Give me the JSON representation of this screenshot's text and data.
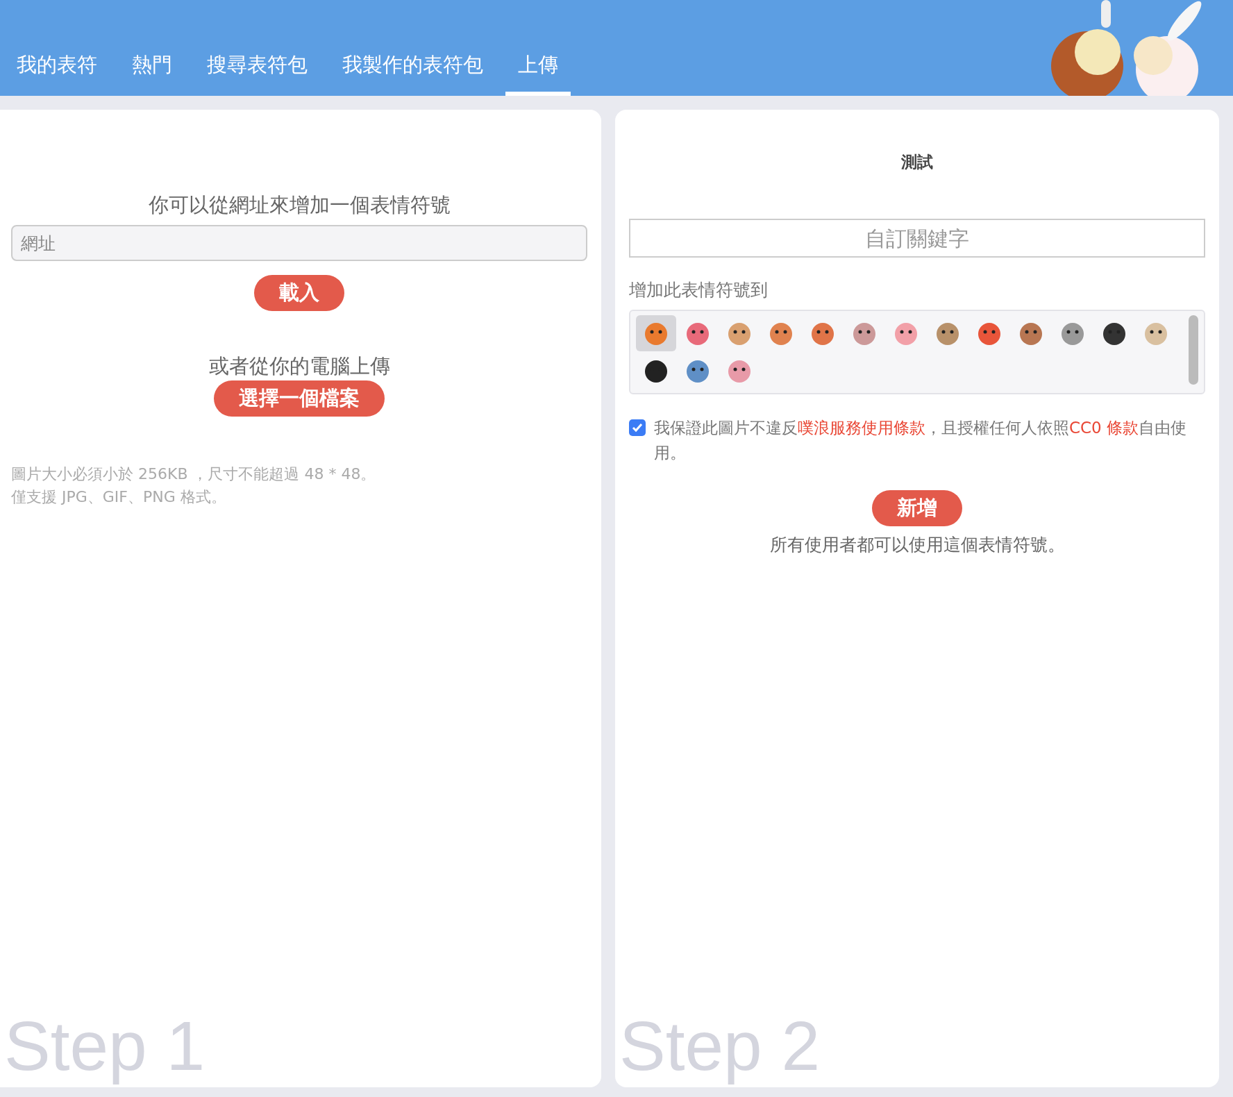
{
  "nav": {
    "tabs": [
      {
        "label": "我的表符",
        "selected": false
      },
      {
        "label": "熱門",
        "selected": false
      },
      {
        "label": "搜尋表符包",
        "selected": false
      },
      {
        "label": "我製作的表符包",
        "selected": false
      },
      {
        "label": "上傳",
        "selected": true
      }
    ]
  },
  "step1": {
    "heading": "你可以從網址來增加一個表情符號",
    "url_field": {
      "placeholder": "網址"
    },
    "load_button": "載入",
    "upload_heading": "或者從你的電腦上傳",
    "choose_button": "選擇一個檔案",
    "notes": [
      "圖片大小必須小於 256KB ，尺寸不能超過 48 * 48。",
      "僅支援 JPG、GIF、PNG 格式。"
    ],
    "watermark": "Step 1"
  },
  "step2": {
    "preview_label": "測試",
    "keyword_field": {
      "placeholder": "自訂關鍵字"
    },
    "add_to_label": "增加此表情符號到",
    "packs": [
      {
        "selected": true
      },
      {
        "selected": false
      },
      {
        "selected": false
      },
      {
        "selected": false
      },
      {
        "selected": false
      },
      {
        "selected": false
      },
      {
        "selected": false
      },
      {
        "selected": false
      },
      {
        "selected": false
      },
      {
        "selected": false
      },
      {
        "selected": false
      },
      {
        "selected": false
      },
      {
        "selected": false
      },
      {
        "selected": false
      },
      {
        "selected": false
      },
      {
        "selected": false
      }
    ],
    "agreement": {
      "checked": true,
      "text": "我保證此圖片不違反",
      "link1": "噗浪服務使用條款",
      "middle": "，且授權任何人依照",
      "link2": "CC0 條款",
      "end": "自由使用。"
    },
    "add_button": "新增",
    "public_note": "所有使用者都可以使用這個表情符號。",
    "watermark": "Step 2"
  }
}
